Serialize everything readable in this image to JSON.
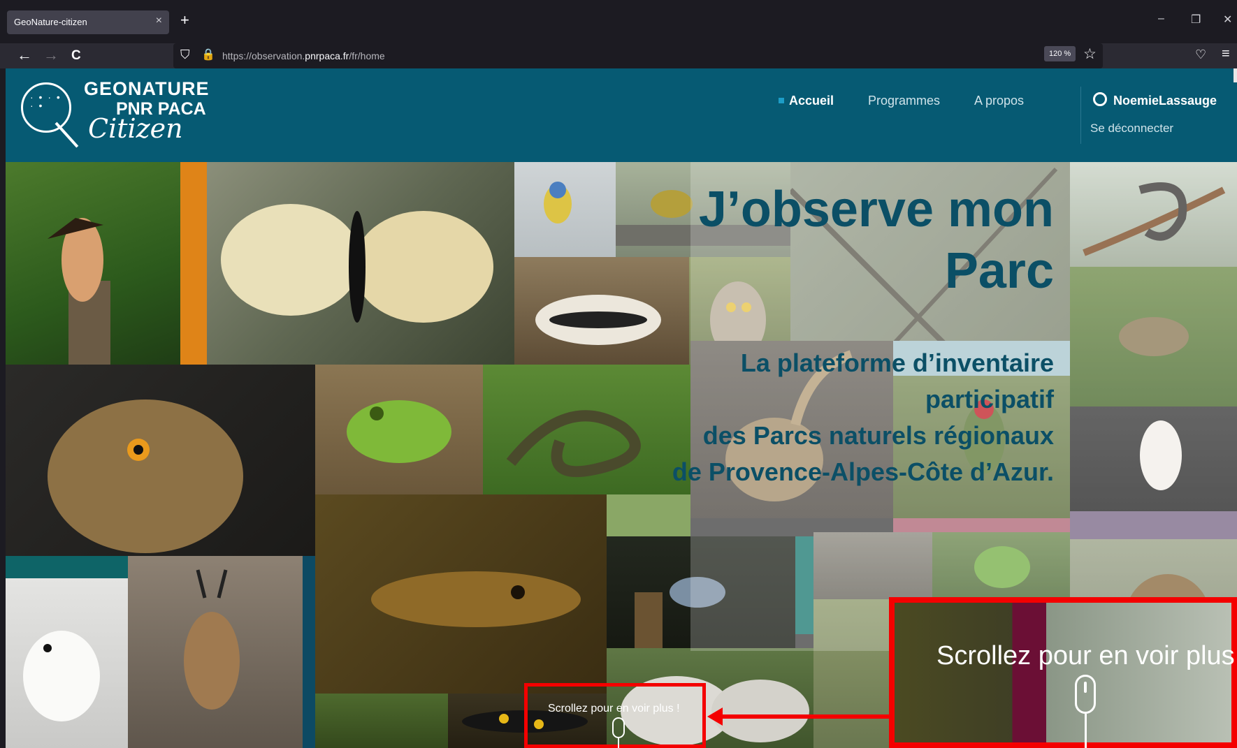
{
  "browser": {
    "tab_title": "GeoNature-citizen",
    "tab_close": "×",
    "new_tab": "+",
    "url_prefix": "https://observation.",
    "url_domain": "pnrpaca.fr",
    "url_path": "/fr/home",
    "zoom": "120 %",
    "back": "←",
    "forward": "→",
    "reload": "C",
    "minimize": "–",
    "restore": "❐",
    "close": "✕",
    "star": "☆",
    "pocket": "♡",
    "menu": "≡",
    "shield": "⛉",
    "lock": "🔒"
  },
  "site": {
    "logo_geonature": "GEONATURE",
    "logo_pnr": "PNR PACA",
    "logo_citizen": "Citizen",
    "logo_dots": "· • · • · •",
    "nav": [
      {
        "label": "Accueil",
        "active": true
      },
      {
        "label": "Programmes",
        "active": false
      },
      {
        "label": "A propos",
        "active": false
      }
    ],
    "user_name": "NoemieLassauge",
    "logout": "Se déconnecter"
  },
  "hero": {
    "title_line1": "J’observe mon",
    "title_line2": "Parc",
    "subtitle_line1": "La plateforme d’inventaire",
    "subtitle_line2": "participatif",
    "subtitle_line3": "des Parcs naturels régionaux",
    "subtitle_line4": "de Provence-Alpes-Côte d’Azur."
  },
  "callouts": {
    "small_text": "Scrollez pour en voir plus !",
    "large_text": "Scrollez pour en voir plus"
  },
  "colors": {
    "header": "#065a73",
    "hero_text": "#0b4f66",
    "callout": "#f40000"
  }
}
